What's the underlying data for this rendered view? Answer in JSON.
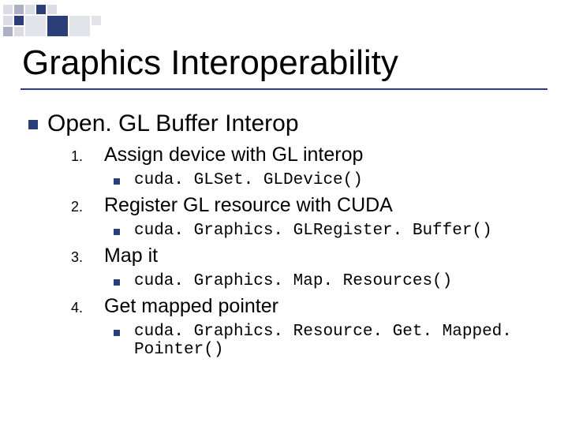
{
  "title": "Graphics Interoperability",
  "heading": "Open. GL Buffer Interop",
  "steps": [
    {
      "num": "1.",
      "label": "Assign device with GL interop",
      "code": "cuda. GLSet. GLDevice()"
    },
    {
      "num": "2.",
      "label": "Register GL resource with CUDA",
      "code": "cuda. Graphics. GLRegister. Buffer()"
    },
    {
      "num": "3.",
      "label": "Map it",
      "code": "cuda. Graphics. Map. Resources()"
    },
    {
      "num": "4.",
      "label": "Get mapped pointer",
      "code": "cuda. Graphics. Resource. Get. Mapped. Pointer()"
    }
  ]
}
